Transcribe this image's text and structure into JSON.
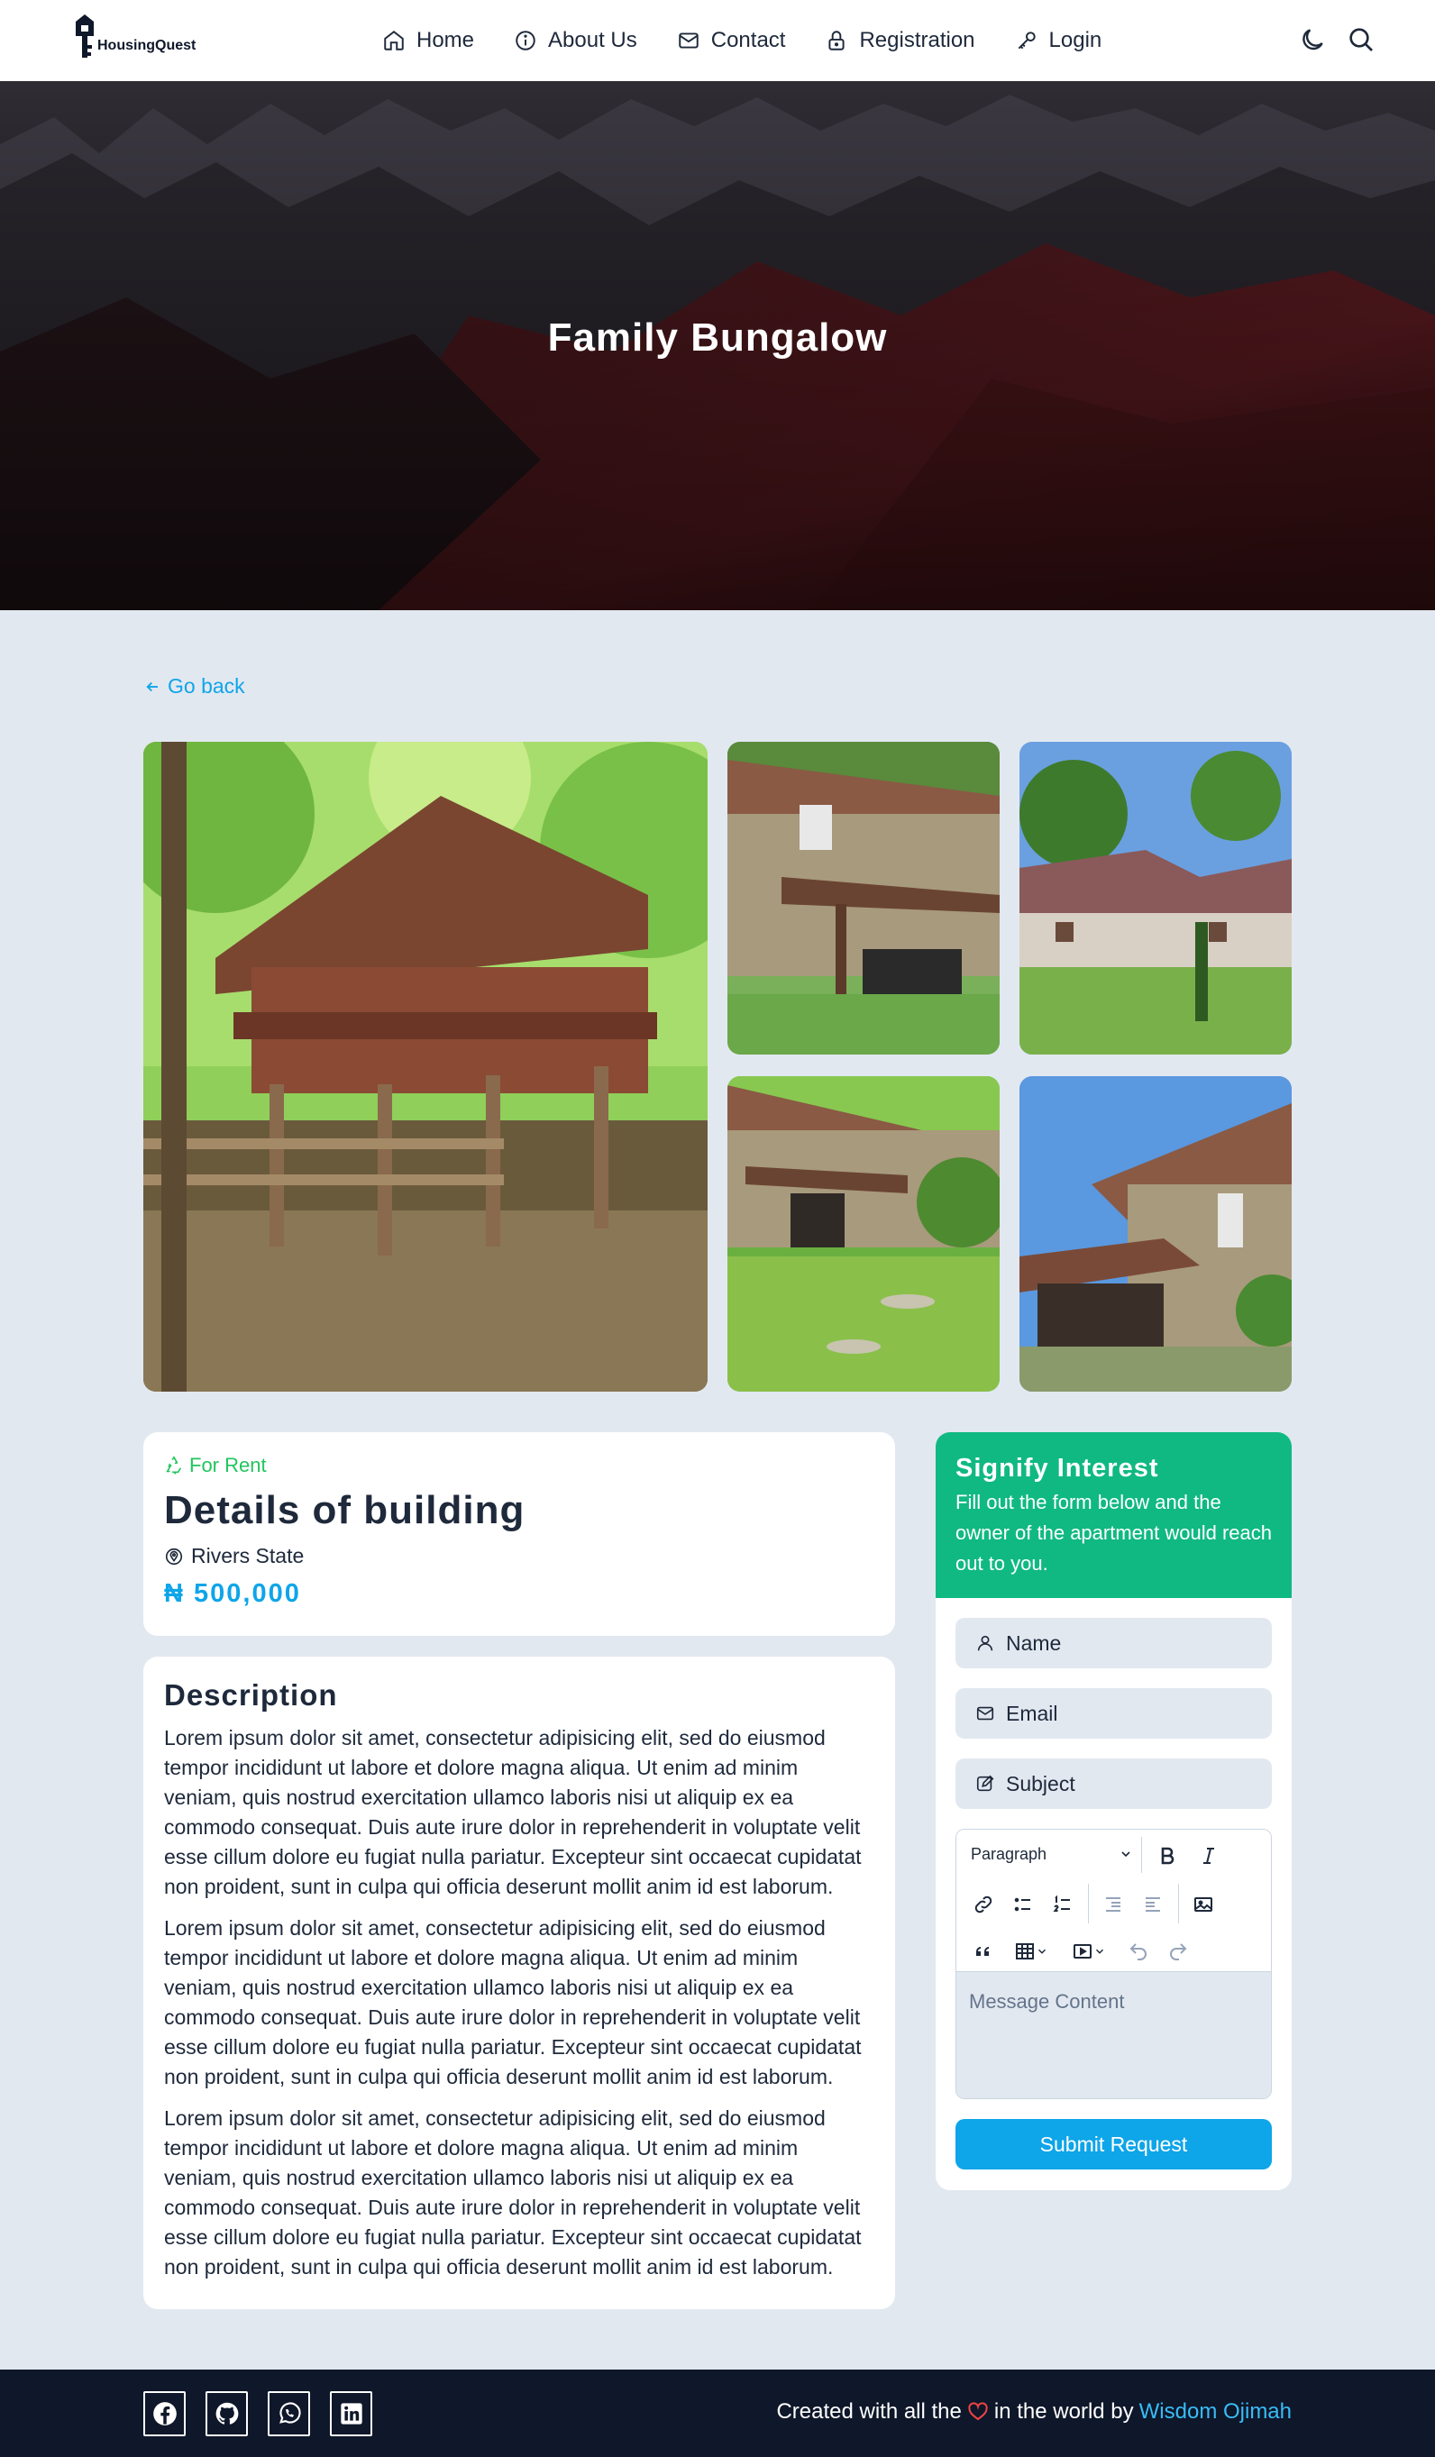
{
  "brand": {
    "name": "HousingQuest"
  },
  "nav": {
    "items": [
      {
        "label": "Home",
        "icon": "home-icon"
      },
      {
        "label": "About Us",
        "icon": "info-icon"
      },
      {
        "label": "Contact",
        "icon": "mail-icon"
      },
      {
        "label": "Registration",
        "icon": "lock-icon"
      },
      {
        "label": "Login",
        "icon": "key-icon"
      }
    ],
    "right_icons": [
      "moon-icon",
      "search-icon"
    ]
  },
  "hero": {
    "title": "Family Bungalow"
  },
  "back": {
    "label": "Go back"
  },
  "details": {
    "badge": "For Rent",
    "title": "Details of building",
    "location": "Rivers State",
    "price": "₦ 500,000"
  },
  "description": {
    "title": "Description",
    "paragraphs": [
      "Lorem ipsum dolor sit amet, consectetur adipisicing elit, sed do eiusmod tempor incididunt ut labore et dolore magna aliqua. Ut enim ad minim veniam, quis nostrud exercitation ullamco laboris nisi ut aliquip ex ea commodo consequat. Duis aute irure dolor in reprehenderit in voluptate velit esse cillum dolore eu fugiat nulla pariatur. Excepteur sint occaecat cupidatat non proident, sunt in culpa qui officia deserunt mollit anim id est laborum.",
      "Lorem ipsum dolor sit amet, consectetur adipisicing elit, sed do eiusmod tempor incididunt ut labore et dolore magna aliqua. Ut enim ad minim veniam, quis nostrud exercitation ullamco laboris nisi ut aliquip ex ea commodo consequat. Duis aute irure dolor in reprehenderit in voluptate velit esse cillum dolore eu fugiat nulla pariatur. Excepteur sint occaecat cupidatat non proident, sunt in culpa qui officia deserunt mollit anim id est laborum.",
      "Lorem ipsum dolor sit amet, consectetur adipisicing elit, sed do eiusmod tempor incididunt ut labore et dolore magna aliqua. Ut enim ad minim veniam, quis nostrud exercitation ullamco laboris nisi ut aliquip ex ea commodo consequat. Duis aute irure dolor in reprehenderit in voluptate velit esse cillum dolore eu fugiat nulla pariatur. Excepteur sint occaecat cupidatat non proident, sunt in culpa qui officia deserunt mollit anim id est laborum."
    ]
  },
  "interest_form": {
    "title": "Signify Interest",
    "subtitle": "Fill out the form below and the owner of the apartment would reach out to you.",
    "name_placeholder": "Name",
    "email_placeholder": "Email",
    "subject_placeholder": "Subject",
    "paragraph_select": "Paragraph",
    "message_placeholder": "Message Content",
    "submit_label": "Submit Request"
  },
  "footer": {
    "socials": [
      "facebook-icon",
      "github-icon",
      "whatsapp-icon",
      "linkedin-icon"
    ],
    "credit_prefix": "Created with all the",
    "credit_middle": "in the world by",
    "author": "Wisdom Ojimah"
  },
  "colors": {
    "primary": "#0ea5e9",
    "success": "#10b981",
    "rent_green": "#22c55e",
    "page_bg": "#e2e8f0",
    "footer_bg": "#0f172a",
    "heart": "#ef4444"
  }
}
